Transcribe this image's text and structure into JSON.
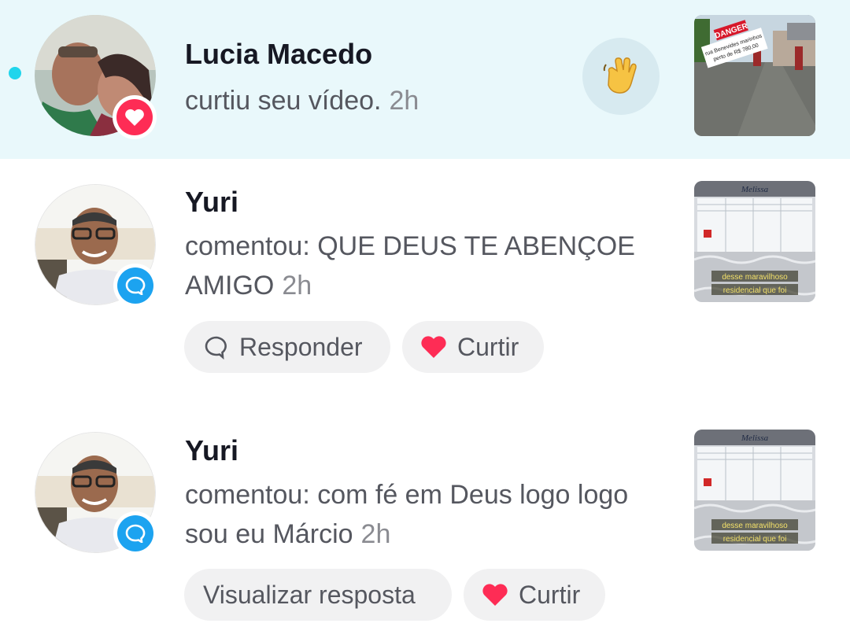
{
  "notifications": [
    {
      "name": "Lucia Macedo",
      "action": "curtiu seu vídeo.",
      "time": "2h",
      "badge_icon": "heart-icon",
      "unread": true,
      "quick_action_icon": "waving-hand-icon"
    },
    {
      "name": "Yuri",
      "action": "comentou: QUE DEUS TE ABENÇOE AMIGO",
      "time": "2h",
      "badge_icon": "comment-icon",
      "buttons": {
        "reply": "Responder",
        "like": "Curtir"
      },
      "thumb_caption": [
        "desse maravilhoso",
        "residencial que foi"
      ]
    },
    {
      "name": "Yuri",
      "action": "comentou: com fé em Deus logo logo sou eu Márcio",
      "time": "2h",
      "badge_icon": "comment-icon",
      "buttons": {
        "view_reply": "Visualizar resposta",
        "like": "Curtir"
      },
      "thumb_caption": [
        "desse maravilhoso",
        "residencial que foi"
      ]
    }
  ],
  "thumb1_overlay": {
    "tag": "DANGER",
    "line1": "rua Benevides marinhos",
    "line2": "perto de R$ 780,00"
  },
  "thumb_brand": "Melissa",
  "colors": {
    "unread_bg": "#e9f8fb",
    "accent_pink": "#fe2c55",
    "accent_blue": "#1ca3f0",
    "dot": "#20d5ec"
  }
}
